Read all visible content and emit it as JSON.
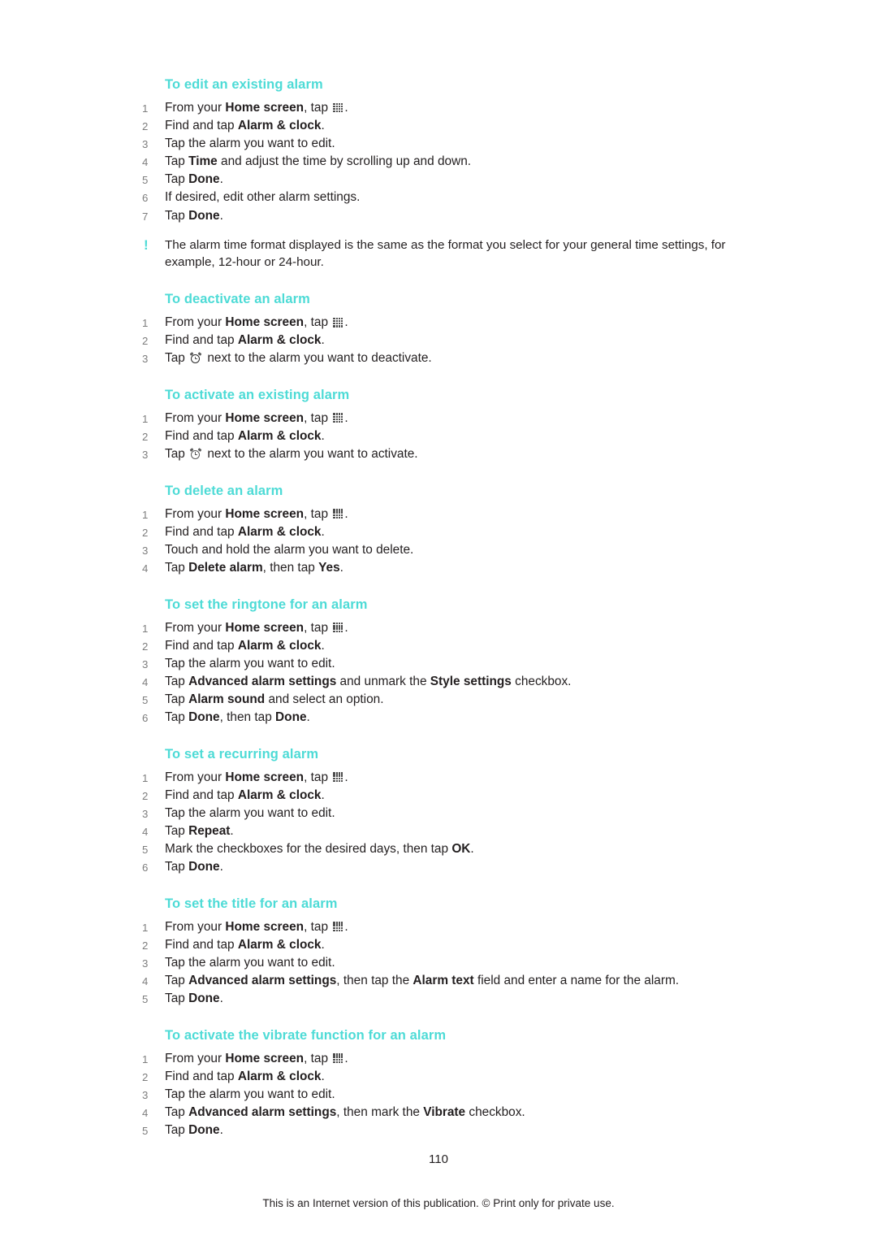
{
  "page": {
    "number": "110",
    "footer": "This is an Internet version of this publication. © Print only for private use."
  },
  "icons": {
    "apps": "apps-grid-icon",
    "alarm_on": "alarm-clock-on-icon",
    "alarm_off": "alarm-clock-off-icon",
    "note": "!"
  },
  "sections": [
    {
      "title": "To edit an existing alarm",
      "steps": [
        {
          "num": "1",
          "parts": [
            {
              "t": "From your "
            },
            {
              "t": "Home screen",
              "b": true
            },
            {
              "t": ", tap "
            },
            {
              "icon": "apps"
            },
            {
              "t": "."
            }
          ]
        },
        {
          "num": "2",
          "parts": [
            {
              "t": "Find and tap "
            },
            {
              "t": "Alarm & clock",
              "b": true
            },
            {
              "t": "."
            }
          ]
        },
        {
          "num": "3",
          "parts": [
            {
              "t": "Tap the alarm you want to edit."
            }
          ]
        },
        {
          "num": "4",
          "parts": [
            {
              "t": "Tap "
            },
            {
              "t": "Time",
              "b": true
            },
            {
              "t": " and adjust the time by scrolling up and down."
            }
          ]
        },
        {
          "num": "5",
          "parts": [
            {
              "t": "Tap "
            },
            {
              "t": "Done",
              "b": true
            },
            {
              "t": "."
            }
          ]
        },
        {
          "num": "6",
          "parts": [
            {
              "t": "If desired, edit other alarm settings."
            }
          ]
        },
        {
          "num": "7",
          "parts": [
            {
              "t": "Tap "
            },
            {
              "t": "Done",
              "b": true
            },
            {
              "t": "."
            }
          ]
        }
      ],
      "note": "The alarm time format displayed is the same as the format you select for your general time settings, for example, 12-hour or 24-hour."
    },
    {
      "title": "To deactivate an alarm",
      "steps": [
        {
          "num": "1",
          "parts": [
            {
              "t": "From your "
            },
            {
              "t": "Home screen",
              "b": true
            },
            {
              "t": ", tap "
            },
            {
              "icon": "apps"
            },
            {
              "t": "."
            }
          ]
        },
        {
          "num": "2",
          "parts": [
            {
              "t": "Find and tap "
            },
            {
              "t": "Alarm & clock",
              "b": true
            },
            {
              "t": "."
            }
          ]
        },
        {
          "num": "3",
          "parts": [
            {
              "t": "Tap "
            },
            {
              "icon": "alarm_on"
            },
            {
              "t": " next to the alarm you want to deactivate."
            }
          ]
        }
      ]
    },
    {
      "title": "To activate an existing alarm",
      "steps": [
        {
          "num": "1",
          "parts": [
            {
              "t": "From your "
            },
            {
              "t": "Home screen",
              "b": true
            },
            {
              "t": ", tap "
            },
            {
              "icon": "apps"
            },
            {
              "t": "."
            }
          ]
        },
        {
          "num": "2",
          "parts": [
            {
              "t": "Find and tap "
            },
            {
              "t": "Alarm & clock",
              "b": true
            },
            {
              "t": "."
            }
          ]
        },
        {
          "num": "3",
          "parts": [
            {
              "t": "Tap "
            },
            {
              "icon": "alarm_off"
            },
            {
              "t": " next to the alarm you want to activate."
            }
          ]
        }
      ]
    },
    {
      "title": "To delete an alarm",
      "steps": [
        {
          "num": "1",
          "parts": [
            {
              "t": "From your "
            },
            {
              "t": "Home screen",
              "b": true
            },
            {
              "t": ", tap "
            },
            {
              "icon": "apps"
            },
            {
              "t": "."
            }
          ]
        },
        {
          "num": "2",
          "parts": [
            {
              "t": "Find and tap "
            },
            {
              "t": "Alarm & clock",
              "b": true
            },
            {
              "t": "."
            }
          ]
        },
        {
          "num": "3",
          "parts": [
            {
              "t": "Touch and hold the alarm you want to delete."
            }
          ]
        },
        {
          "num": "4",
          "parts": [
            {
              "t": "Tap "
            },
            {
              "t": "Delete alarm",
              "b": true
            },
            {
              "t": ", then tap "
            },
            {
              "t": "Yes",
              "b": true
            },
            {
              "t": "."
            }
          ]
        }
      ]
    },
    {
      "title": "To set the ringtone for an alarm",
      "steps": [
        {
          "num": "1",
          "parts": [
            {
              "t": "From your "
            },
            {
              "t": "Home screen",
              "b": true
            },
            {
              "t": ", tap "
            },
            {
              "icon": "apps"
            },
            {
              "t": "."
            }
          ]
        },
        {
          "num": "2",
          "parts": [
            {
              "t": "Find and tap "
            },
            {
              "t": "Alarm & clock",
              "b": true
            },
            {
              "t": "."
            }
          ]
        },
        {
          "num": "3",
          "parts": [
            {
              "t": "Tap the alarm you want to edit."
            }
          ]
        },
        {
          "num": "4",
          "parts": [
            {
              "t": "Tap "
            },
            {
              "t": "Advanced alarm settings",
              "b": true
            },
            {
              "t": " and unmark the "
            },
            {
              "t": "Style settings",
              "b": true
            },
            {
              "t": " checkbox."
            }
          ]
        },
        {
          "num": "5",
          "parts": [
            {
              "t": "Tap "
            },
            {
              "t": "Alarm sound",
              "b": true
            },
            {
              "t": " and select an option."
            }
          ]
        },
        {
          "num": "6",
          "parts": [
            {
              "t": "Tap "
            },
            {
              "t": "Done",
              "b": true
            },
            {
              "t": ", then tap "
            },
            {
              "t": "Done",
              "b": true
            },
            {
              "t": "."
            }
          ]
        }
      ]
    },
    {
      "title": "To set a recurring alarm",
      "steps": [
        {
          "num": "1",
          "parts": [
            {
              "t": "From your "
            },
            {
              "t": "Home screen",
              "b": true
            },
            {
              "t": ", tap "
            },
            {
              "icon": "apps"
            },
            {
              "t": "."
            }
          ]
        },
        {
          "num": "2",
          "parts": [
            {
              "t": "Find and tap "
            },
            {
              "t": "Alarm & clock",
              "b": true
            },
            {
              "t": "."
            }
          ]
        },
        {
          "num": "3",
          "parts": [
            {
              "t": "Tap the alarm you want to edit."
            }
          ]
        },
        {
          "num": "4",
          "parts": [
            {
              "t": "Tap "
            },
            {
              "t": "Repeat",
              "b": true
            },
            {
              "t": "."
            }
          ]
        },
        {
          "num": "5",
          "parts": [
            {
              "t": "Mark the checkboxes for the desired days, then tap "
            },
            {
              "t": "OK",
              "b": true
            },
            {
              "t": "."
            }
          ]
        },
        {
          "num": "6",
          "parts": [
            {
              "t": "Tap "
            },
            {
              "t": "Done",
              "b": true
            },
            {
              "t": "."
            }
          ]
        }
      ]
    },
    {
      "title": "To set the title for an alarm",
      "steps": [
        {
          "num": "1",
          "parts": [
            {
              "t": "From your "
            },
            {
              "t": "Home screen",
              "b": true
            },
            {
              "t": ", tap "
            },
            {
              "icon": "apps"
            },
            {
              "t": "."
            }
          ]
        },
        {
          "num": "2",
          "parts": [
            {
              "t": "Find and tap "
            },
            {
              "t": "Alarm & clock",
              "b": true
            },
            {
              "t": "."
            }
          ]
        },
        {
          "num": "3",
          "parts": [
            {
              "t": "Tap the alarm you want to edit."
            }
          ]
        },
        {
          "num": "4",
          "parts": [
            {
              "t": "Tap "
            },
            {
              "t": "Advanced alarm settings",
              "b": true
            },
            {
              "t": ", then tap the "
            },
            {
              "t": "Alarm text",
              "b": true
            },
            {
              "t": " field and enter a name for the alarm."
            }
          ]
        },
        {
          "num": "5",
          "parts": [
            {
              "t": "Tap "
            },
            {
              "t": "Done",
              "b": true
            },
            {
              "t": "."
            }
          ]
        }
      ]
    },
    {
      "title": "To activate the vibrate function for an alarm",
      "steps": [
        {
          "num": "1",
          "parts": [
            {
              "t": "From your "
            },
            {
              "t": "Home screen",
              "b": true
            },
            {
              "t": ", tap "
            },
            {
              "icon": "apps"
            },
            {
              "t": "."
            }
          ]
        },
        {
          "num": "2",
          "parts": [
            {
              "t": "Find and tap "
            },
            {
              "t": "Alarm & clock",
              "b": true
            },
            {
              "t": "."
            }
          ]
        },
        {
          "num": "3",
          "parts": [
            {
              "t": "Tap the alarm you want to edit."
            }
          ]
        },
        {
          "num": "4",
          "parts": [
            {
              "t": "Tap "
            },
            {
              "t": "Advanced alarm settings",
              "b": true
            },
            {
              "t": ", then mark the "
            },
            {
              "t": "Vibrate",
              "b": true
            },
            {
              "t": " checkbox."
            }
          ]
        },
        {
          "num": "5",
          "parts": [
            {
              "t": "Tap "
            },
            {
              "t": "Done",
              "b": true
            },
            {
              "t": "."
            }
          ]
        }
      ]
    }
  ],
  "colors": {
    "heading": "#4ddbd6",
    "text": "#231f20",
    "step_number": "#7d7d7d"
  }
}
